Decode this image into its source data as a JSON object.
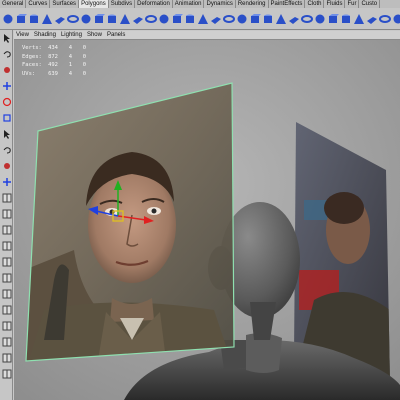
{
  "shelf_tabs": [
    {
      "label": "General",
      "active": false
    },
    {
      "label": "Curves",
      "active": false
    },
    {
      "label": "Surfaces",
      "active": false
    },
    {
      "label": "Polygons",
      "active": true
    },
    {
      "label": "Subdivs",
      "active": false
    },
    {
      "label": "Deformation",
      "active": false
    },
    {
      "label": "Animation",
      "active": false
    },
    {
      "label": "Dynamics",
      "active": false
    },
    {
      "label": "Rendering",
      "active": false
    },
    {
      "label": "PaintEffects",
      "active": false
    },
    {
      "label": "Cloth",
      "active": false
    },
    {
      "label": "Fluids",
      "active": false
    },
    {
      "label": "Fur",
      "active": false
    },
    {
      "label": "Custo",
      "active": false
    }
  ],
  "colors": {
    "ui_gray": "#c6c6c6",
    "viewport_bg": "#a0a0a0",
    "selection_outline": "#8fe0b0",
    "shelf_icon_blue": "#2a4fc8",
    "manip_x": "#e02020",
    "manip_y": "#20b020",
    "manip_z": "#2040e0",
    "manip_center": "#e0c020"
  },
  "shelf_icons": [
    "poly-sphere-icon",
    "poly-cube-icon",
    "poly-cylinder-icon",
    "poly-cone-icon",
    "poly-plane-icon",
    "poly-torus-icon",
    "poly-prism-icon",
    "poly-pyramid-icon",
    "poly-pipe-icon",
    "combine-icon",
    "separate-icon",
    "extract-icon",
    "smooth-icon",
    "boolean-union-icon",
    "boolean-difference-icon",
    "boolean-intersection-icon",
    "mirror-icon",
    "reduce-icon",
    "triangulate-icon",
    "quadrangulate-icon",
    "fill-hole-icon",
    "append-icon",
    "split-icon",
    "cut-faces-icon",
    "extrude-face-icon",
    "extrude-edge-icon",
    "bevel-icon",
    "duplicate-face-icon",
    "merge-vertices-icon",
    "merge-edges-icon",
    "delete-edge-icon",
    "collapse-icon",
    "subdivide-icon",
    "wedge-icon",
    "poke-icon",
    "chamfer-icon",
    "soften-edge-icon",
    "harden-edge-icon",
    "reverse-icon",
    "conform-icon",
    "planar-mapping-icon",
    "cylindrical-mapping-icon",
    "spherical-mapping-icon",
    "automatic-mapping-icon",
    "uv-editor-icon",
    "normalize-uvs-icon",
    "unitize-uvs-icon",
    "flip-uvs-icon",
    "rotate-uvs-icon",
    "layout-uvs-icon",
    "sew-uvs-icon",
    "cut-uvs-icon"
  ],
  "tools": [
    "select-arrow-icon",
    "lasso-icon",
    "paint-select-icon",
    "move-tool-icon",
    "rotate-tool-icon",
    "scale-tool-icon",
    "universal-manip-icon",
    "soft-mod-icon",
    "show-manip-icon",
    "last-tool-icon",
    "single-pane-layout-icon",
    "four-pane-layout-icon",
    "side-by-side-layout-icon",
    "persp-outliner-layout-icon",
    "graph-layout-icon",
    "hypershade-layout-icon",
    "render-layout-icon",
    "uv-layout-icon",
    "script-layout-icon",
    "blend-layout-icon",
    "dope-layout-icon",
    "trax-layout-icon"
  ],
  "panel_menu": [
    "View",
    "Shading",
    "Lighting",
    "Show",
    "Panels"
  ],
  "hud": [
    {
      "label": "Verts:",
      "v1": "434",
      "v2": "4",
      "v3": "0"
    },
    {
      "label": "Edges:",
      "v1": "872",
      "v2": "4",
      "v3": "0"
    },
    {
      "label": "Faces:",
      "v1": "492",
      "v2": "1",
      "v3": "0"
    },
    {
      "label": "UVs:",
      "v1": "639",
      "v2": "4",
      "v3": "0"
    }
  ]
}
